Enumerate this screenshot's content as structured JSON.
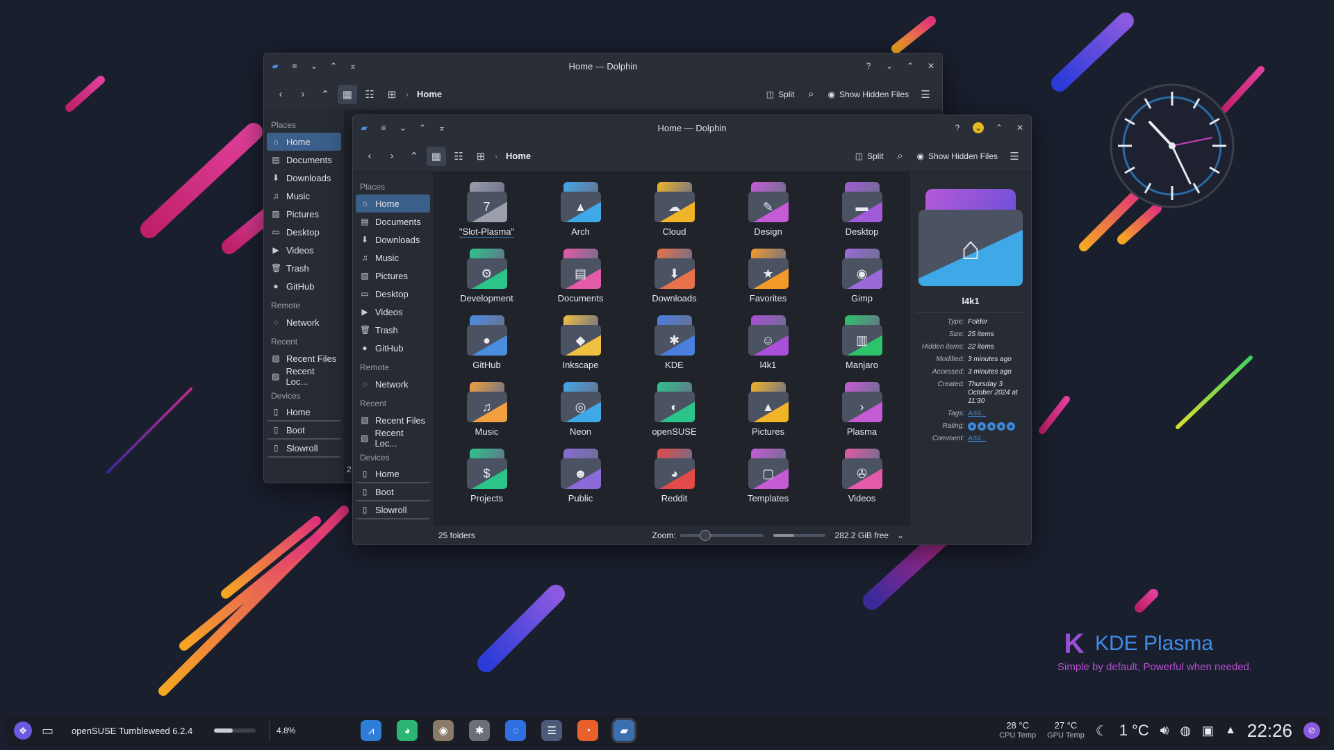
{
  "colors": {
    "accent": "#3c8ad8",
    "window_bg": "#272b33",
    "content_bg": "#20232a",
    "desktop_bg": "#1a1f2e"
  },
  "branding": {
    "logo_text": "KDE Plasma",
    "tagline": "Simple by default, Powerful when needed."
  },
  "back_window": {
    "title": "Home — Dolphin",
    "breadcrumb": "Home",
    "split_label": "Split",
    "show_hidden_label": "Show Hidden Files",
    "status_fragment": "2",
    "sidebar": {
      "places_heading": "Places",
      "places": [
        {
          "label": "Home",
          "icon": "home-icon"
        },
        {
          "label": "Documents",
          "icon": "documents-icon"
        },
        {
          "label": "Downloads",
          "icon": "downloads-icon"
        },
        {
          "label": "Music",
          "icon": "music-icon"
        },
        {
          "label": "Pictures",
          "icon": "pictures-icon"
        },
        {
          "label": "Desktop",
          "icon": "desktop-icon"
        },
        {
          "label": "Videos",
          "icon": "videos-icon"
        },
        {
          "label": "Trash",
          "icon": "trash-icon"
        },
        {
          "label": "GitHub",
          "icon": "github-icon"
        }
      ],
      "remote_heading": "Remote",
      "remote": [
        {
          "label": "Network",
          "icon": "network-icon"
        }
      ],
      "recent_heading": "Recent",
      "recent": [
        {
          "label": "Recent Files",
          "icon": "recent-files-icon"
        },
        {
          "label": "Recent Loc...",
          "icon": "recent-locations-icon"
        }
      ],
      "devices_heading": "Devices",
      "devices": [
        {
          "label": "Home",
          "icon": "drive-icon"
        },
        {
          "label": "Boot",
          "icon": "drive-icon"
        },
        {
          "label": "Slowroll",
          "icon": "drive-icon"
        }
      ]
    }
  },
  "front_window": {
    "title": "Home — Dolphin",
    "breadcrumb": "Home",
    "split_label": "Split",
    "show_hidden_label": "Show Hidden Files",
    "sidebar": {
      "places_heading": "Places",
      "places": [
        {
          "label": "Home",
          "icon": "home-icon"
        },
        {
          "label": "Documents",
          "icon": "documents-icon"
        },
        {
          "label": "Downloads",
          "icon": "downloads-icon"
        },
        {
          "label": "Music",
          "icon": "music-icon"
        },
        {
          "label": "Pictures",
          "icon": "pictures-icon"
        },
        {
          "label": "Desktop",
          "icon": "desktop-icon"
        },
        {
          "label": "Videos",
          "icon": "videos-icon"
        },
        {
          "label": "Trash",
          "icon": "trash-icon"
        },
        {
          "label": "GitHub",
          "icon": "github-icon"
        }
      ],
      "remote_heading": "Remote",
      "remote": [
        {
          "label": "Network",
          "icon": "network-icon"
        }
      ],
      "recent_heading": "Recent",
      "recent": [
        {
          "label": "Recent Files",
          "icon": "recent-files-icon"
        },
        {
          "label": "Recent Loc...",
          "icon": "recent-locations-icon"
        }
      ],
      "devices_heading": "Devices",
      "devices": [
        {
          "label": "Home",
          "icon": "drive-icon"
        },
        {
          "label": "Boot",
          "icon": "drive-icon"
        },
        {
          "label": "Slowroll",
          "icon": "drive-icon"
        }
      ]
    },
    "folders": [
      {
        "label": "\"Slot-Plasma\"",
        "glyph": "7",
        "tab": "#9a9fab"
      },
      {
        "label": "Arch",
        "glyph": "▲",
        "tab": "#3fa8e6"
      },
      {
        "label": "Cloud",
        "glyph": "☁",
        "tab": "#f0b429"
      },
      {
        "label": "Design",
        "glyph": "✎",
        "tab": "#c65bd6"
      },
      {
        "label": "Desktop",
        "glyph": "▬",
        "tab": "#a15ad8"
      },
      {
        "label": "Development",
        "glyph": "⚙",
        "tab": "#2bc48a"
      },
      {
        "label": "Documents",
        "glyph": "▤",
        "tab": "#e35aa8"
      },
      {
        "label": "Downloads",
        "glyph": "⬇",
        "tab": "#e8714a"
      },
      {
        "label": "Favorites",
        "glyph": "★",
        "tab": "#f39a2a"
      },
      {
        "label": "Gimp",
        "glyph": "◉",
        "tab": "#9a6bd8"
      },
      {
        "label": "GitHub",
        "glyph": "●",
        "tab": "#4b8ee0"
      },
      {
        "label": "Inkscape",
        "glyph": "◆",
        "tab": "#f0c040"
      },
      {
        "label": "KDE",
        "glyph": "✱",
        "tab": "#4a7fe0"
      },
      {
        "label": "l4k1",
        "glyph": "☺",
        "tab": "#a94fd8"
      },
      {
        "label": "Manjaro",
        "glyph": "▥",
        "tab": "#2bc46a"
      },
      {
        "label": "Music",
        "glyph": "♫",
        "tab": "#f0a040"
      },
      {
        "label": "Neon",
        "glyph": "◎",
        "tab": "#3fa8e6"
      },
      {
        "label": "openSUSE",
        "glyph": "◐",
        "tab": "#2bc48a"
      },
      {
        "label": "Pictures",
        "glyph": "▲",
        "tab": "#f0b429"
      },
      {
        "label": "Plasma",
        "glyph": "›",
        "tab": "#c65bd6"
      },
      {
        "label": "Projects",
        "glyph": "$",
        "tab": "#2bc48a"
      },
      {
        "label": "Public",
        "glyph": "☻",
        "tab": "#8a6bd8"
      },
      {
        "label": "Reddit",
        "glyph": "◕",
        "tab": "#e34a4a"
      },
      {
        "label": "Templates",
        "glyph": "▢",
        "tab": "#c65bd6"
      },
      {
        "label": "Videos",
        "glyph": "✇",
        "tab": "#e35aa8"
      }
    ],
    "status": {
      "count": "25 folders",
      "zoom_label": "Zoom:",
      "free_space": "282.2 GiB free"
    },
    "info_panel": {
      "name": "l4k1",
      "rows": [
        {
          "k": "Type:",
          "v": "Folder"
        },
        {
          "k": "Size:",
          "v": "25 items"
        },
        {
          "k": "Hidden items:",
          "v": "22 items"
        },
        {
          "k": "Modified:",
          "v": "3 minutes ago"
        },
        {
          "k": "Accessed:",
          "v": "3 minutes ago"
        },
        {
          "k": "Created:",
          "v": "Thursday 3 October 2024 at 11:30"
        }
      ],
      "tags_label": "Tags:",
      "tags_value": "Add...",
      "rating_label": "Rating:",
      "rating_stars": 5,
      "comment_label": "Comment:",
      "comment_value": "Add..."
    }
  },
  "taskbar": {
    "task_label": "openSUSE Tumbleweed 6.2.4",
    "cpu_percent": "4.8%",
    "cpu_temp": "28 °C",
    "cpu_temp_label": "CPU Temp",
    "gpu_temp": "27 °C",
    "gpu_temp_label": "GPU Temp",
    "weather": "1 °C",
    "clock": "22:26",
    "apps": [
      {
        "name": "system-monitor-icon",
        "bg": "#2e7dd6",
        "glyph": "⩘"
      },
      {
        "name": "mastodon-icon",
        "bg": "#2bb673",
        "glyph": "◕"
      },
      {
        "name": "gimp-icon",
        "bg": "#8a7a6a",
        "glyph": "◉"
      },
      {
        "name": "settings-icon",
        "bg": "#6a6f7a",
        "glyph": "✱"
      },
      {
        "name": "discover-icon",
        "bg": "#2f6fe0",
        "glyph": "◌"
      },
      {
        "name": "control-panel-icon",
        "bg": "#4a5a78",
        "glyph": "☰"
      },
      {
        "name": "firefox-icon",
        "bg": "#e8602a",
        "glyph": "◔"
      },
      {
        "name": "dolphin-icon",
        "bg": "#3b6fb0",
        "glyph": "▰"
      }
    ]
  }
}
